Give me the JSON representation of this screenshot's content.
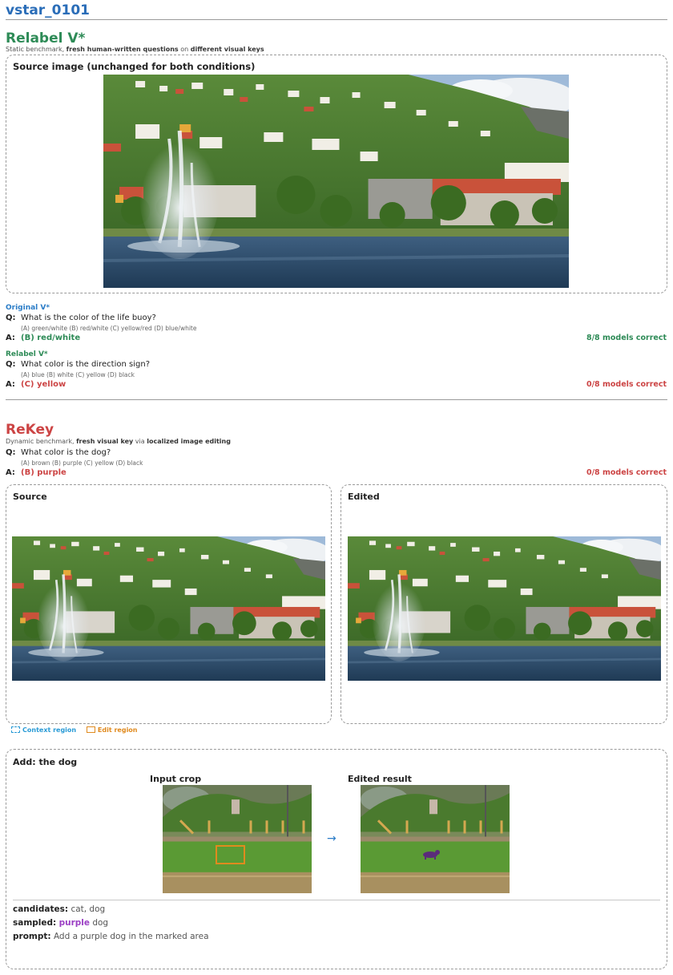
{
  "page_id": "vstar_0101",
  "relabel": {
    "title": "Relabel V*",
    "subtitle_parts": [
      "Static benchmark, ",
      "fresh human-written questions",
      " on ",
      "different visual keys"
    ],
    "source_box_label": "Source image (unchanged for both conditions)",
    "original": {
      "heading": "Original V*",
      "q_tag": "Q:",
      "question": "What is the color of the life buoy?",
      "options": "(A) green/white   (B) red/white   (C) yellow/red   (D) blue/white",
      "a_tag": "A:",
      "answer": "(B) red/white",
      "score": "8/8 models correct"
    },
    "relabeled": {
      "heading": "Relabel V*",
      "q_tag": "Q:",
      "question": "What color is the direction sign?",
      "options": "(A) blue   (B) white   (C) yellow   (D) black",
      "a_tag": "A:",
      "answer": "(C) yellow",
      "score": "0/8 models correct"
    }
  },
  "rekey": {
    "title": "ReKey",
    "subtitle_parts": [
      "Dynamic benchmark, ",
      "fresh visual key",
      " via ",
      "localized image editing"
    ],
    "q_tag": "Q:",
    "question": "What color is the dog?",
    "options": "(A) brown   (B) purple   (C) yellow   (D) black",
    "a_tag": "A:",
    "answer": "(B) purple",
    "score": "0/8 models correct",
    "source_label": "Source",
    "edited_label": "Edited",
    "legend_context": "Context region",
    "legend_edit": "Edit region"
  },
  "edit_detail": {
    "title": "Add: the dog",
    "input_crop_label": "Input crop",
    "edited_result_label": "Edited result",
    "arrow": "→",
    "candidates_label": "candidates:",
    "candidates_value": "cat, dog",
    "sampled_label": "sampled:",
    "sampled_color": "purple",
    "sampled_object": "dog",
    "prompt_label": "prompt:",
    "prompt_value": "Add a purple dog in the marked area"
  },
  "colors": {
    "blue_accent": "#2a6db8",
    "green": "#2e8b57",
    "red": "#cc4444",
    "purple": "#9b3fc4",
    "context_blue": "#2a9bd6",
    "edit_orange": "#e08a1e"
  }
}
